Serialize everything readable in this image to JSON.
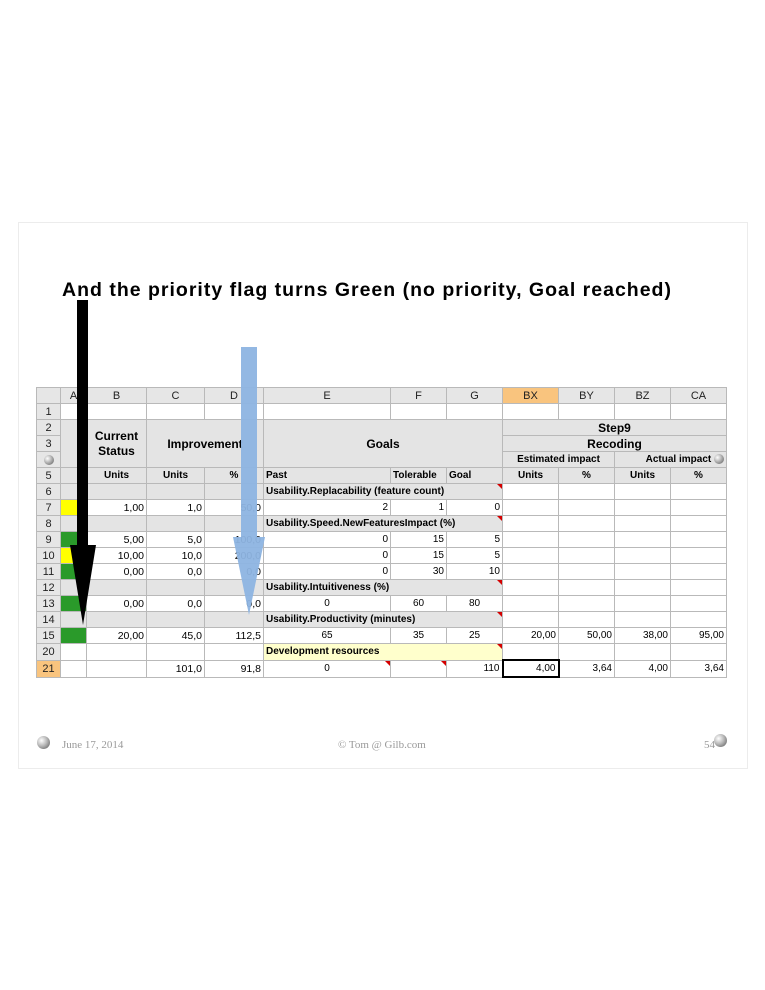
{
  "slide": {
    "title": "And the priority flag turns Green (no priority, Goal reached)",
    "footer_date": "June 17, 2014",
    "footer_center": "© Tom @ Gilb.com",
    "footer_page": "54"
  },
  "sheet": {
    "columns": [
      "A",
      "B",
      "C",
      "D",
      "E",
      "F",
      "G",
      "BX",
      "BY",
      "BZ",
      "CA"
    ],
    "selected_column": "BX",
    "rows": [
      "1",
      "2",
      "3",
      "4",
      "5",
      "6",
      "7",
      "8",
      "9",
      "10",
      "11",
      "12",
      "13",
      "14",
      "15",
      "20",
      "21"
    ],
    "selected_row": "21",
    "headers": {
      "current_status": "Current Status",
      "improvement": "Improvement",
      "goals": "Goals",
      "step": "Step9",
      "step_name": "Recoding",
      "estimated_impact": "Estimated impact",
      "actual_impact": "Actual impact",
      "units": "Units",
      "percent": "%",
      "past": "Past",
      "tolerable": "Tolerable",
      "goal": "Goal"
    },
    "sections": {
      "replacability": "Usability.Replacability (feature count)",
      "speed": "Usability.Speed.NewFeaturesImpact (%)",
      "intuitiveness": "Usability.Intuitiveness (%)",
      "productivity": "Usability.Productivity (minutes)",
      "development": "Development resources"
    },
    "row7": {
      "flag": "yellow",
      "cur": "1,00",
      "imp_units": "1,0",
      "imp_pct": "50,0",
      "past": "2",
      "tol": "1",
      "goal": "0"
    },
    "row9": {
      "flag": "green",
      "cur": "5,00",
      "imp_units": "5,0",
      "imp_pct": "100,0",
      "past": "0",
      "tol": "15",
      "goal": "5"
    },
    "row10": {
      "flag": "yellow",
      "cur": "10,00",
      "imp_units": "10,0",
      "imp_pct": "200,0",
      "past": "0",
      "tol": "15",
      "goal": "5"
    },
    "row11": {
      "flag": "green",
      "cur": "0,00",
      "imp_units": "0,0",
      "imp_pct": "0,0",
      "past": "0",
      "tol": "30",
      "goal": "10"
    },
    "row13": {
      "flag": "green",
      "cur": "0,00",
      "imp_units": "0,0",
      "imp_pct": "0,0",
      "past": "0",
      "tol": "60",
      "goal": "80"
    },
    "row15": {
      "flag": "green",
      "cur": "20,00",
      "imp_units": "45,0",
      "imp_pct": "112,5",
      "past": "65",
      "tol": "35",
      "goal": "25",
      "est_units": "20,00",
      "est_pct": "50,00",
      "act_units": "38,00",
      "act_pct": "95,00"
    },
    "row21": {
      "imp_units": "101,0",
      "imp_pct": "91,8",
      "past": "0",
      "goal": "110",
      "est_units": "4,00",
      "est_pct": "3,64",
      "act_units": "4,00",
      "act_pct": "3,64"
    }
  },
  "colors": {
    "flag_green": "#2a9a2a",
    "flag_yellow": "#ffff00",
    "black_arrow": "#000000",
    "blue_arrow": "#8db4e2"
  }
}
